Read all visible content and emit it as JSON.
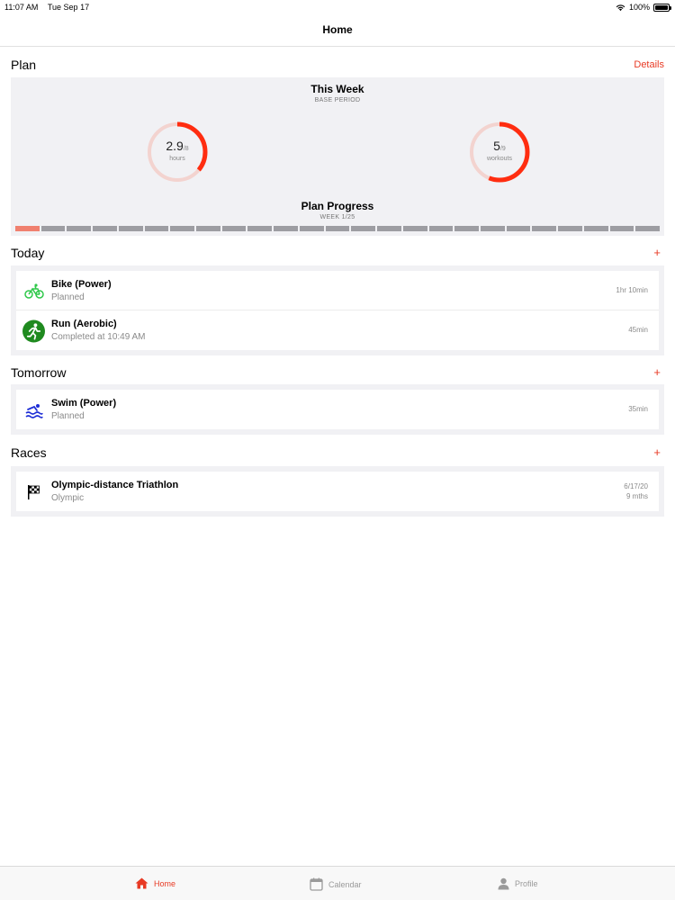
{
  "status": {
    "time": "11:07 AM",
    "date": "Tue Sep 17",
    "battery": "100%",
    "battery_level": 1.0
  },
  "nav": {
    "title": "Home"
  },
  "plan": {
    "title": "Plan",
    "details": "Details",
    "week_title": "This Week",
    "week_sub": "BASE PERIOD",
    "hours": {
      "value": "2.9",
      "total": "/8",
      "label": "hours",
      "fraction": 0.36
    },
    "workouts": {
      "value": "5",
      "total": "/9",
      "label": "workouts",
      "fraction": 0.56
    },
    "progress_title": "Plan Progress",
    "progress_sub": "WEEK 1/25",
    "progress_current": 1,
    "progress_total": 25
  },
  "today": {
    "title": "Today",
    "add": "+",
    "items": [
      {
        "title": "Bike (Power)",
        "sub": "Planned",
        "meta": "1hr 10min",
        "icon": "bike-icon"
      },
      {
        "title": "Run (Aerobic)",
        "sub": "Completed at 10:49 AM",
        "meta": "45min",
        "icon": "run-icon"
      }
    ]
  },
  "tomorrow": {
    "title": "Tomorrow",
    "add": "+",
    "items": [
      {
        "title": "Swim (Power)",
        "sub": "Planned",
        "meta": "35min",
        "icon": "swim-icon"
      }
    ]
  },
  "races": {
    "title": "Races",
    "add": "+",
    "items": [
      {
        "title": "Olympic-distance Triathlon",
        "sub": "Olympic",
        "meta_date": "6/17/20",
        "meta_rel": "9 mths",
        "icon": "checkered-flag-icon"
      }
    ]
  },
  "tabs": [
    {
      "label": "Home",
      "icon": "home-icon",
      "active": true
    },
    {
      "label": "Calendar",
      "icon": "calendar-icon",
      "active": false
    },
    {
      "label": "Profile",
      "icon": "profile-icon",
      "active": false
    }
  ],
  "colors": {
    "accent": "#e83a24",
    "bike": "#2fc84a",
    "run": "#1f8a1f",
    "swim": "#1f2fd6",
    "ring_track": "#f3d3cf"
  }
}
